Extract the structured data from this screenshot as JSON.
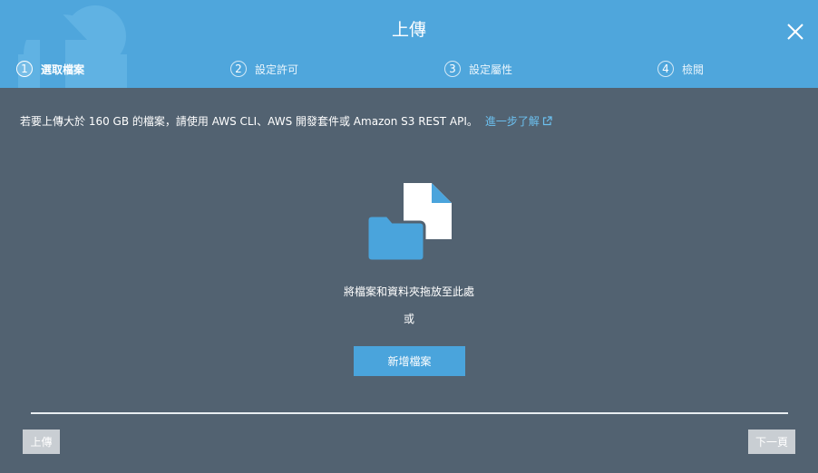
{
  "dialog": {
    "title": "上傳",
    "close_icon": "close-icon",
    "brand_color": "#4fa6dc",
    "background_color": "#526271"
  },
  "steps": [
    {
      "number": "1",
      "label": "選取檔案",
      "active": true
    },
    {
      "number": "2",
      "label": "設定許可",
      "active": false
    },
    {
      "number": "3",
      "label": "設定屬性",
      "active": false
    },
    {
      "number": "4",
      "label": "檢閱",
      "active": false
    }
  ],
  "notice": {
    "text": "若要上傳大於 160 GB 的檔案，請使用 AWS CLI、AWS 開發套件或 Amazon S3 REST API。",
    "link_text": "進一步了解",
    "link_icon": "external-link-icon",
    "link_color": "#6cc0ef"
  },
  "dropzone": {
    "icon": "folder-file-icon",
    "instruction": "將檔案和資料夾拖放至此處",
    "or_text": "或",
    "add_files_label": "新增檔案"
  },
  "footer": {
    "upload_label": "上傳",
    "next_label": "下一頁"
  }
}
